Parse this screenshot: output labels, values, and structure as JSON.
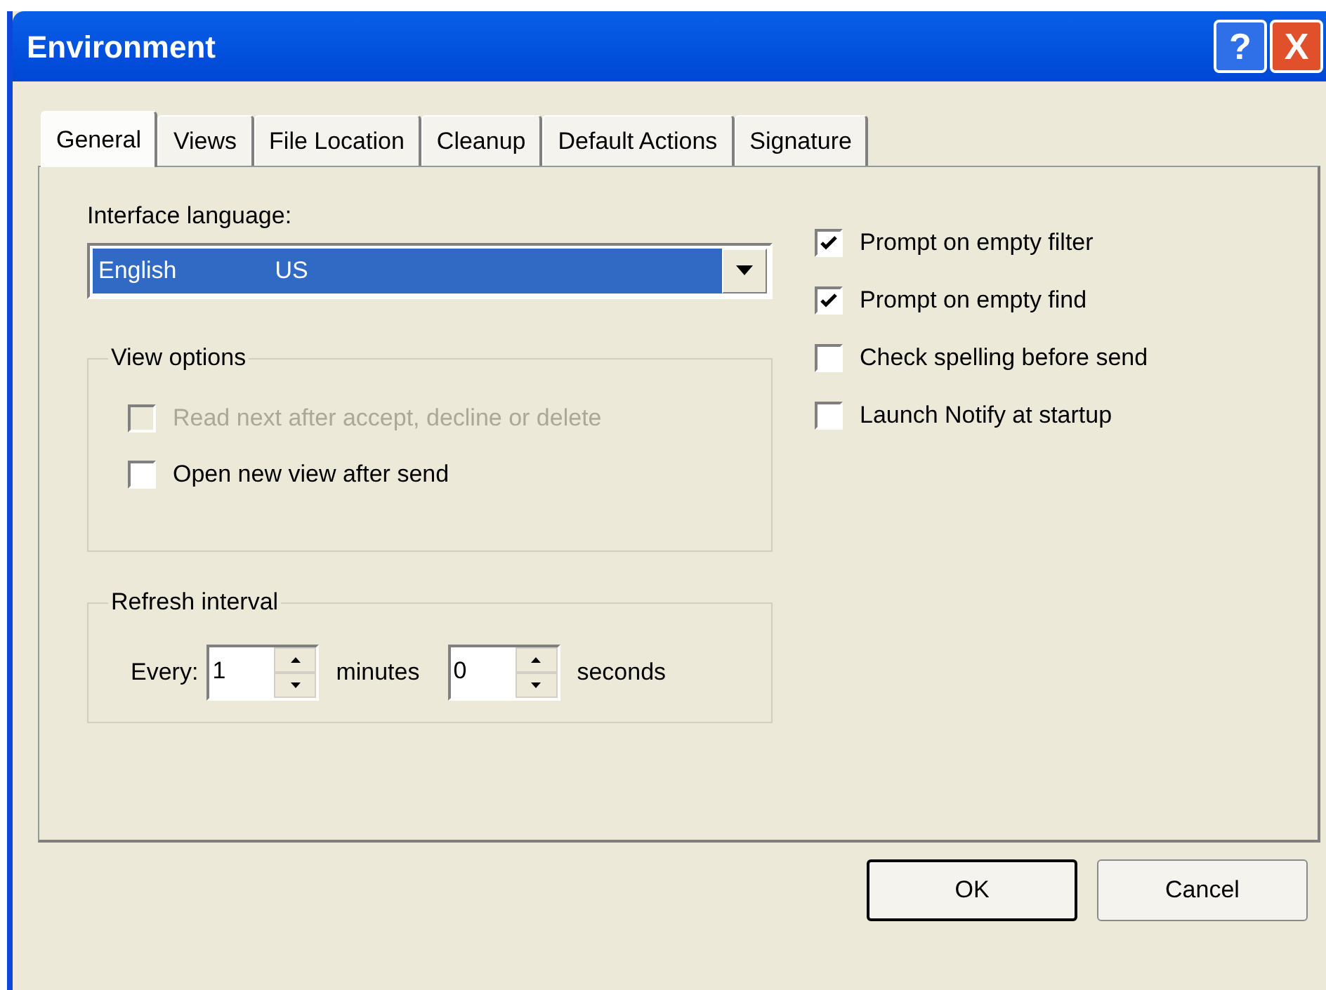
{
  "window": {
    "title": "Environment",
    "title_buttons": [
      {
        "kind": "help",
        "label": "?"
      },
      {
        "kind": "close",
        "label": "X"
      }
    ]
  },
  "tabs": [
    {
      "label": "General",
      "selected": true
    },
    {
      "label": "Views",
      "selected": false
    },
    {
      "label": "File Location",
      "selected": false
    },
    {
      "label": "Cleanup",
      "selected": false
    },
    {
      "label": "Default Actions",
      "selected": false
    },
    {
      "label": "Signature",
      "selected": false
    }
  ],
  "interface_language": {
    "label": "Interface language:",
    "value": "English",
    "region": "US"
  },
  "view_options": {
    "title": "View options",
    "items": [
      {
        "label": "Read next after accept, decline or delete",
        "checked": false,
        "disabled": true
      },
      {
        "label": "Open new view after send",
        "checked": false,
        "disabled": false
      }
    ]
  },
  "refresh_interval": {
    "title": "Refresh interval",
    "every_label": "Every:",
    "minutes_value": "1",
    "minutes_label": "minutes",
    "seconds_value": "0",
    "seconds_label": "seconds"
  },
  "options": [
    {
      "label": "Prompt on empty filter",
      "checked": true
    },
    {
      "label": "Prompt on empty find",
      "checked": true
    },
    {
      "label": "Check spelling before send",
      "checked": false
    },
    {
      "label": "Launch Notify at startup",
      "checked": false
    }
  ],
  "buttons": [
    {
      "label": "OK",
      "default": true
    },
    {
      "label": "Cancel",
      "default": false
    }
  ]
}
